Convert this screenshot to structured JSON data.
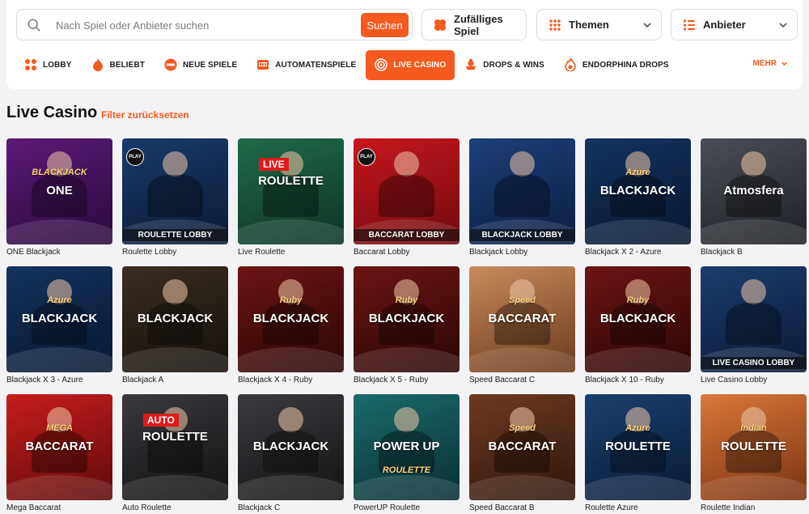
{
  "search": {
    "placeholder": "Nach Spiel oder Anbieter suchen",
    "button": "Suchen"
  },
  "toolbar": {
    "random": "Zufälliges Spiel",
    "themes": "Themen",
    "providers": "Anbieter"
  },
  "nav": [
    {
      "label": "LOBBY",
      "icon": "grid-icon"
    },
    {
      "label": "BELIEBT",
      "icon": "flame-icon"
    },
    {
      "label": "NEUE SPIELE",
      "icon": "new-badge-icon"
    },
    {
      "label": "AUTOMATENSPIELE",
      "icon": "slot-machine-icon"
    },
    {
      "label": "LIVE CASINO",
      "icon": "live-broadcast-icon",
      "active": true
    },
    {
      "label": "DROPS & WINS",
      "icon": "drops-icon"
    },
    {
      "label": "ENDORPHINA DROPS",
      "icon": "flame-drop-icon"
    }
  ],
  "more": "MEHR",
  "page": {
    "title": "Live Casino",
    "reset": "Filter zurücksetzen"
  },
  "games": [
    {
      "name": "ONE Blackjack",
      "overlay": "ONE",
      "sub": "BLACKJACK",
      "bg": [
        "#5b1a78",
        "#2a0a3c"
      ]
    },
    {
      "name": "Roulette Lobby",
      "overlay": "ROULETTE LOBBY",
      "badge": "PLAY",
      "bg": [
        "#1a3a6a",
        "#0c1a33"
      ]
    },
    {
      "name": "Live Roulette",
      "overlay": "ROULETTE",
      "tag": "LIVE",
      "bg": [
        "#1f6b4a",
        "#0d3325"
      ]
    },
    {
      "name": "Baccarat Lobby",
      "overlay": "BACCARAT LOBBY",
      "badge": "PLAY",
      "bg": [
        "#c8161e",
        "#6e0a10"
      ]
    },
    {
      "name": "Blackjack Lobby",
      "overlay": "BLACKJACK LOBBY",
      "bg": [
        "#1e3f7a",
        "#0b1d40"
      ]
    },
    {
      "name": "Blackjack X 2 - Azure",
      "overlay": "BLACKJACK",
      "sub": "Azure",
      "bg": [
        "#15325e",
        "#081830"
      ]
    },
    {
      "name": "Blackjack B",
      "overlay": "Atmosfera",
      "bg": [
        "#4a4e56",
        "#1e2026"
      ]
    },
    {
      "name": "Blackjack X 3 - Azure",
      "overlay": "BLACKJACK",
      "sub": "Azure",
      "bg": [
        "#15325e",
        "#081830"
      ]
    },
    {
      "name": "Blackjack A",
      "overlay": "BLACKJACK",
      "bg": [
        "#3a2e22",
        "#15100b"
      ]
    },
    {
      "name": "Blackjack X 4 - Ruby",
      "overlay": "BLACKJACK",
      "sub": "Ruby",
      "bg": [
        "#6e1414",
        "#2a0606"
      ]
    },
    {
      "name": "Blackjack X 5 - Ruby",
      "overlay": "BLACKJACK",
      "sub": "Ruby",
      "bg": [
        "#6e1414",
        "#2a0606"
      ]
    },
    {
      "name": "Speed Baccarat C",
      "overlay": "BACCARAT",
      "sub": "Speed",
      "bg": [
        "#c98a5a",
        "#6b3a1c"
      ]
    },
    {
      "name": "Blackjack X 10 - Ruby",
      "overlay": "BLACKJACK",
      "sub": "Ruby",
      "bg": [
        "#6e1414",
        "#2a0606"
      ]
    },
    {
      "name": "Live Casino Lobby",
      "overlay": "LIVE CASINO LOBBY",
      "bg": [
        "#1d3c6e",
        "#0b1a36"
      ]
    },
    {
      "name": "Mega Baccarat",
      "overlay": "BACCARAT",
      "sub": "MEGA",
      "bg": [
        "#c81c1c",
        "#5e0a0a"
      ]
    },
    {
      "name": "Auto Roulette",
      "overlay": "ROULETTE",
      "tag": "AUTO",
      "bg": [
        "#3a3a3e",
        "#111113"
      ]
    },
    {
      "name": "Blackjack C",
      "overlay": "BLACKJACK",
      "bg": [
        "#3b3b3f",
        "#141416"
      ]
    },
    {
      "name": "PowerUP Roulette",
      "overlay": "POWER UP",
      "sub": "ROULETTE",
      "bg": [
        "#1a6b6a",
        "#0a2e33"
      ]
    },
    {
      "name": "Speed Baccarat B",
      "overlay": "BACCARAT",
      "sub": "Speed",
      "bg": [
        "#6e3a22",
        "#2e160c"
      ]
    },
    {
      "name": "Roulette Azure",
      "overlay": "ROULETTE",
      "sub": "Azure",
      "bg": [
        "#1c3f6e",
        "#0a1b36"
      ]
    },
    {
      "name": "Roulette Indian",
      "overlay": "ROULETTE",
      "sub": "Indian",
      "bg": [
        "#d9783a",
        "#7a3210"
      ]
    }
  ],
  "colors": {
    "accent": "#f45a1e",
    "background": "#f3f3f5"
  }
}
